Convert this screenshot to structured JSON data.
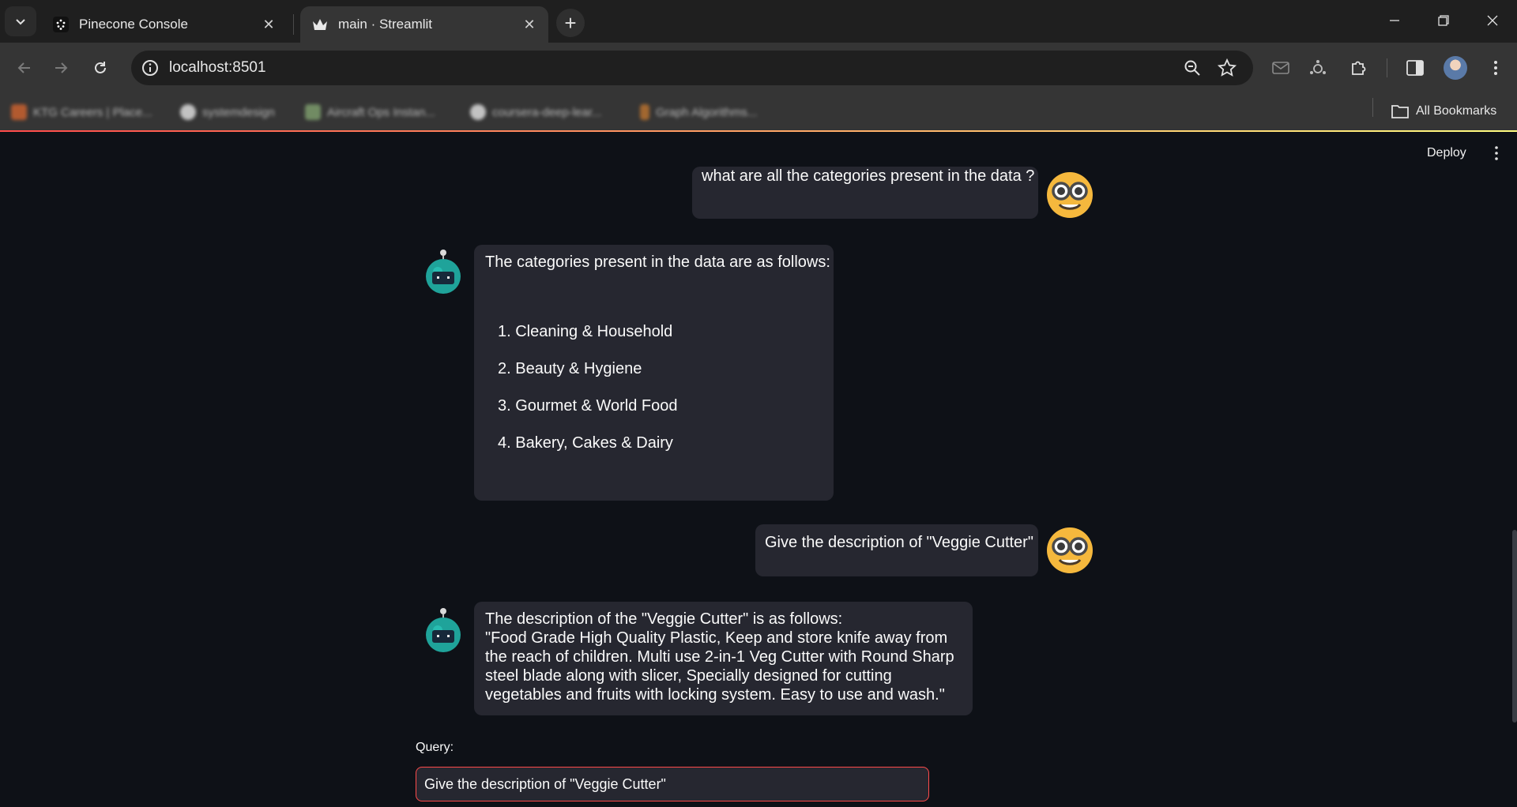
{
  "browser": {
    "tabs": [
      {
        "title": "Pinecone Console",
        "favicon": "pinecone-icon",
        "active": false
      },
      {
        "title": "main · Streamlit",
        "favicon": "streamlit-crown-icon",
        "active": true
      }
    ],
    "address": "localhost:8501",
    "bookmarks": [
      {
        "label": "KTG Careers | Place...",
        "icon": "ktg-favicon"
      },
      {
        "label": "systemdesign",
        "icon": "github-icon"
      },
      {
        "label": "Aircraft Ops Instan...",
        "icon": "page-favicon"
      },
      {
        "label": "coursera-deep-lear...",
        "icon": "github-icon"
      },
      {
        "label": "Graph Algorithms...",
        "icon": "page-favicon"
      }
    ],
    "all_bookmarks_label": "All Bookmarks"
  },
  "app": {
    "deploy_label": "Deploy",
    "messages": [
      {
        "role": "user",
        "avatar": "nerd-face-emoji",
        "text": "what are all the categories present in the data ?"
      },
      {
        "role": "assistant",
        "avatar": "robot-avatar",
        "intro": "The categories present in the data are as follows:",
        "items": [
          "1. Cleaning & Household",
          "2. Beauty & Hygiene",
          "3. Gourmet & World Food",
          "4. Bakery, Cakes & Dairy"
        ]
      },
      {
        "role": "user",
        "avatar": "nerd-face-emoji",
        "text": "Give the description of \"Veggie Cutter\""
      },
      {
        "role": "assistant",
        "avatar": "robot-avatar",
        "lines": [
          "The description of the \"Veggie Cutter\" is as follows:",
          "\"Food Grade High Quality Plastic, Keep and store knife away from",
          "the reach of children. Multi use 2-in-1 Veg Cutter with Round Sharp",
          "steel blade along with slicer, Specially designed for cutting",
          "vegetables and fruits with locking system. Easy to use and wash.\""
        ]
      }
    ],
    "query_label": "Query:",
    "query_value": "Give the description of \"Veggie Cutter\""
  },
  "colors": {
    "app_bg": "#0e1117",
    "bubble_bg": "#262730",
    "accent": "#ff4b4b",
    "chrome_dark": "#1f1f1f",
    "chrome_light": "#353535"
  }
}
